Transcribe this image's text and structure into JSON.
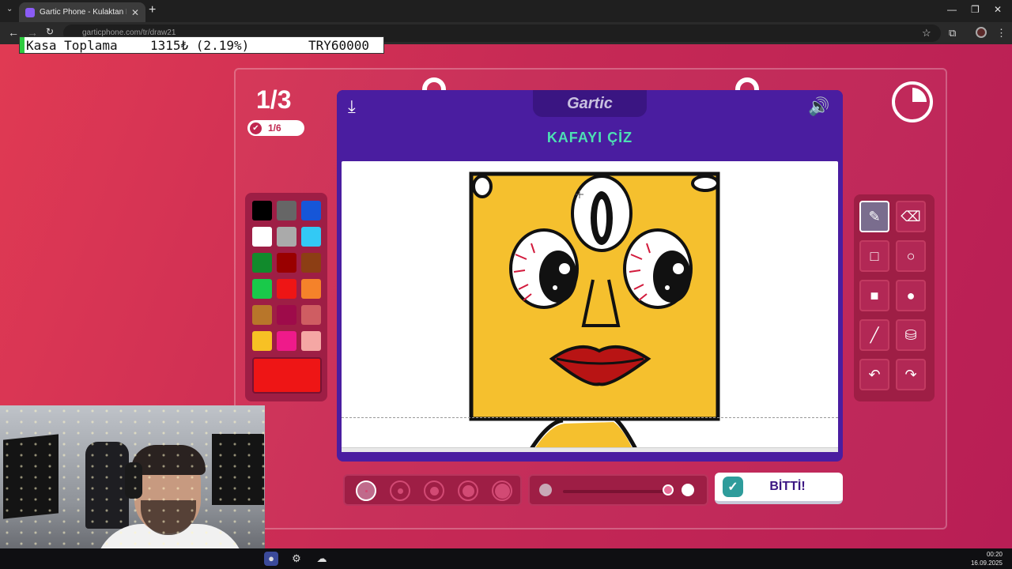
{
  "browser": {
    "tab_title": "Gartic Phone - Kulaktan Kulağa",
    "url": "garticphone.com/tr/draw21",
    "new_tab_icon": "plus-icon",
    "close_icon": "close-icon"
  },
  "overlay": {
    "label": "Kasa Toplama",
    "amount": "1315₺ (2.19%)",
    "goal": "TRY60000"
  },
  "game": {
    "round": "1/3",
    "progress": "1/6",
    "timer_fraction": 0.25,
    "brand": "Gartic",
    "prompt": "KAFAYI ÇİZ",
    "done_label": "BİTTİ!",
    "palette": [
      "#000000",
      "#666666",
      "#1656d8",
      "#ffffff",
      "#aaaaaa",
      "#33c9f5",
      "#118a2c",
      "#990000",
      "#8c3e14",
      "#19c94a",
      "#ee1515",
      "#f5822a",
      "#b8762a",
      "#9e0b4a",
      "#cf5d62",
      "#f7c124",
      "#ef1a8a",
      "#f5a7a4"
    ],
    "selected_color": "#ee1515",
    "tools": [
      "pencil-icon",
      "eraser-icon",
      "rectangle-outline-icon",
      "circle-outline-icon",
      "rectangle-fill-icon",
      "circle-fill-icon",
      "line-icon",
      "bucket-icon",
      "undo-icon",
      "redo-icon"
    ],
    "brush_sizes": 5,
    "selected_size": 1,
    "opacity_level": 0.95
  },
  "taskbar": {
    "time": "00:20",
    "date": "16.09.2025"
  }
}
